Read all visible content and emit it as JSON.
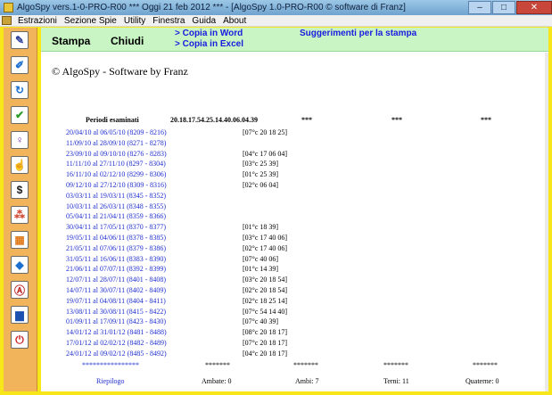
{
  "window": {
    "title": "AlgoSpy vers.1-0-PRO-R00  ***  Oggi 21 feb 2012  ***  - [AlgoSpy 1.0-PRO-R00   © software di Franz]",
    "minimize_glyph": "‒",
    "maximize_glyph": "□",
    "close_glyph": "✕"
  },
  "menu": {
    "items": [
      "Estrazioni",
      "Sezione Spie",
      "Utility",
      "Finestra",
      "Guida",
      "About"
    ]
  },
  "sidebar": {
    "buttons": [
      {
        "icon": "pencil-icon",
        "glyph": "✎",
        "color": "#2a3f9a"
      },
      {
        "icon": "edit-icon",
        "glyph": "✐",
        "color": "#1b6fd0"
      },
      {
        "icon": "refresh-icon",
        "glyph": "↻",
        "color": "#1b6fd0"
      },
      {
        "icon": "check-icon",
        "glyph": "✔",
        "color": "#2a9a2a"
      },
      {
        "icon": "bulb-icon",
        "glyph": "♀",
        "color": "#7a3ab0"
      },
      {
        "icon": "hand-icon",
        "glyph": "☝",
        "color": "#1b3fa0"
      },
      {
        "icon": "money-icon",
        "glyph": "$",
        "color": "#1a1a1a"
      },
      {
        "icon": "network-icon",
        "glyph": "⁂",
        "color": "#d0402a"
      },
      {
        "icon": "grid-icon",
        "glyph": "▦",
        "color": "#e07a1a"
      },
      {
        "icon": "drop-icon",
        "glyph": "◆",
        "color": "#1b6fd0"
      },
      {
        "icon": "a-icon",
        "glyph": "Ⓐ",
        "color": "#c02020"
      },
      {
        "icon": "book-icon",
        "glyph": "▆",
        "color": "#1b4fb0"
      },
      {
        "icon": "power-icon",
        "glyph": "⏻",
        "color": "#d02020"
      }
    ]
  },
  "toolbar": {
    "stampa": "Stampa",
    "chiudi": "Chiudi",
    "copia_word": "> Copia in Word",
    "copia_excel": "> Copia in Excel",
    "suggerimenti": "Suggerimenti per la stampa"
  },
  "report": {
    "copyright": "© AlgoSpy - Software by Franz",
    "header": {
      "periodi": "Periodi esaminati",
      "sequenza": "20.18.17.54.25.14.40.06.04.39",
      "col3": "***",
      "col4": "***",
      "col5": "***"
    },
    "rows": [
      {
        "periodo": "20/04/10 al 06/05/10 (8209 - 8216)",
        "valore": "[07°c 20 18 25]"
      },
      {
        "periodo": "11/09/10 al 28/09/10 (8271 - 8278)",
        "valore": ""
      },
      {
        "periodo": "23/09/10 al 09/10/10 (8276 - 8283)",
        "valore": "[04°c 17 06 04]"
      },
      {
        "periodo": "11/11/10 al 27/11/10 (8297 - 8304)",
        "valore": "[03°c 25 39]"
      },
      {
        "periodo": "16/11/10 al 02/12/10 (8299 - 8306)",
        "valore": "[01°c 25 39]"
      },
      {
        "periodo": "09/12/10 al 27/12/10 (8309 - 8316)",
        "valore": "[02°c 06 04]"
      },
      {
        "periodo": "03/03/11 al 19/03/11 (8345 - 8352)",
        "valore": ""
      },
      {
        "periodo": "10/03/11 al 26/03/11 (8348 - 8355)",
        "valore": ""
      },
      {
        "periodo": "05/04/11 al 21/04/11 (8359 - 8366)",
        "valore": ""
      },
      {
        "periodo": "30/04/11 al 17/05/11 (8370 - 8377)",
        "valore": "[01°c 18 39]"
      },
      {
        "periodo": "19/05/11 al 04/06/11 (8378 - 8385)",
        "valore": "[03°c 17 40 06]"
      },
      {
        "periodo": "21/05/11 al 07/06/11 (8379 - 8386)",
        "valore": "[02°c 17 40 06]"
      },
      {
        "periodo": "31/05/11 al 16/06/11 (8383 - 8390)",
        "valore": "[07°c 40 06]"
      },
      {
        "periodo": "21/06/11 al 07/07/11 (8392 - 8399)",
        "valore": "[01°c 14 39]"
      },
      {
        "periodo": "12/07/11 al 28/07/11 (8401 - 8408)",
        "valore": "[03°c 20 18 54]"
      },
      {
        "periodo": "14/07/11 al 30/07/11 (8402 - 8409)",
        "valore": "[02°c 20 18 54]"
      },
      {
        "periodo": "19/07/11 al 04/08/11 (8404 - 8411)",
        "valore": "[02°c 18 25 14]"
      },
      {
        "periodo": "13/08/11 al 30/08/11 (8415 - 8422)",
        "valore": "[07°c 54 14 40]"
      },
      {
        "periodo": "01/09/11 al 17/09/11 (8423 - 8430)",
        "valore": "[07°c 40 39]"
      },
      {
        "periodo": "14/01/12 al 31/01/12 (8481 - 8488)",
        "valore": "[08°c 20 18 17]"
      },
      {
        "periodo": "17/01/12 al 02/02/12 (8482 - 8489)",
        "valore": "[07°c 20 18 17]"
      },
      {
        "periodo": "24/01/12 al 09/02/12 (8485 - 8492)",
        "valore": "[04°c 20 18 17]"
      }
    ],
    "footer": {
      "stars_blue": "****************",
      "stars1": "*******",
      "stars2": "*******",
      "stars3": "*******",
      "stars4": "*******",
      "riepilogo": "Riepilogo",
      "ambate": "Ambate: 0",
      "ambi": "Ambi: 7",
      "terni": "Terni: 11",
      "quaterne": "Quaterne: 0"
    }
  }
}
